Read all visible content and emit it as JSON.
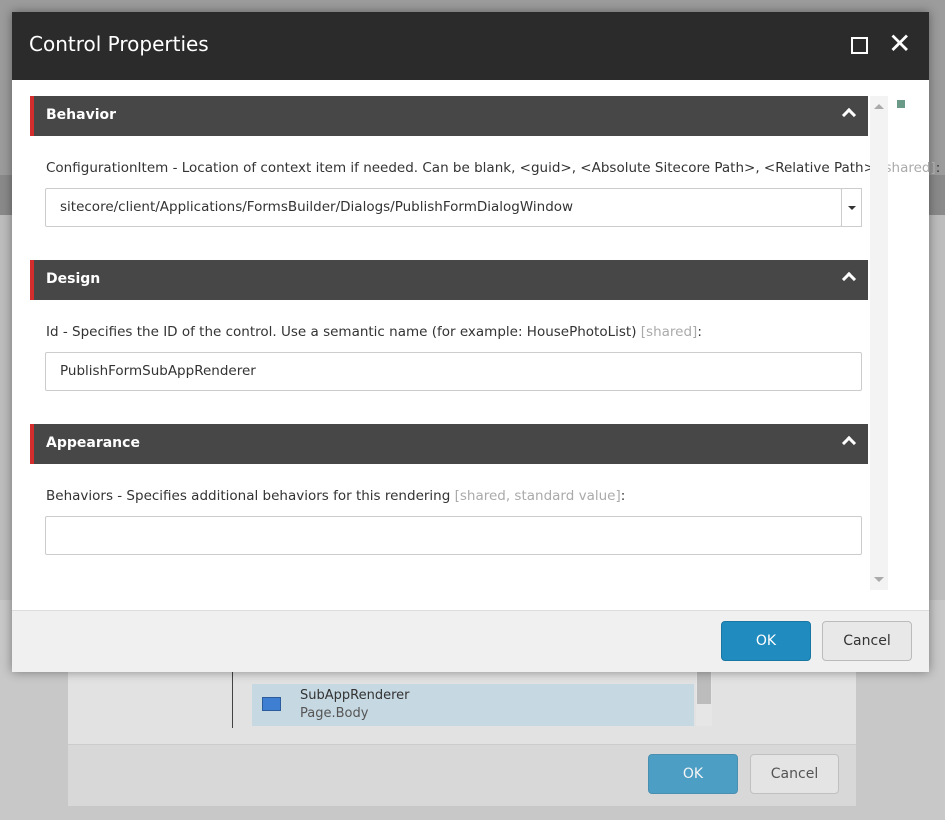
{
  "dialog": {
    "title": "Control Properties",
    "ok_label": "OK",
    "cancel_label": "Cancel"
  },
  "sections": [
    {
      "title": "Behavior",
      "field_label": "ConfigurationItem - Location of context item if needed. Can be blank, <guid>, <Absolute Sitecore Path>, <Relative Path>",
      "field_tag": "[shared]",
      "value": "sitecore/client/Applications/FormsBuilder/Dialogs/PublishFormDialogWindow"
    },
    {
      "title": "Design",
      "field_label": "Id - Specifies the ID of the control. Use a semantic name (for example: HousePhotoList)",
      "field_tag": "[shared]",
      "value": "PublishFormSubAppRenderer"
    },
    {
      "title": "Appearance",
      "field_label": "Behaviors - Specifies additional behaviors for this rendering",
      "field_tag": "[shared, standard value]",
      "value": ""
    }
  ],
  "background": {
    "list_item": {
      "name": "SubAppRenderer",
      "placeholder": "Page.Body"
    },
    "ok_label": "OK",
    "cancel_label": "Cancel"
  },
  "colors": {
    "header": "#2b2b2b",
    "section": "#474747",
    "accent": "#d42d2d",
    "primary": "#1f8bbf"
  }
}
